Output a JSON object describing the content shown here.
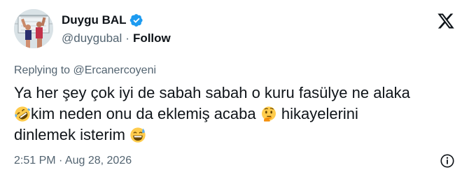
{
  "author": {
    "display_name": "Duygu BAL",
    "handle": "@duygubal",
    "separator": "·",
    "follow_label": "Follow"
  },
  "icons": {
    "verified": "verified-badge-icon",
    "brand": "x-logo-icon",
    "info": "info-icon",
    "emoji_laugh": "rolling-on-floor-laughing-emoji",
    "emoji_think": "thinking-face-emoji",
    "emoji_sweat": "grinning-face-with-sweat-emoji"
  },
  "reply": {
    "prefix": "Replying to ",
    "mention": "@Ercanercoyeni"
  },
  "tweet": {
    "line1": "Ya her şey çok iyi de sabah sabah o kuru fasülye ne alaka",
    "line2a": "kim neden onu da eklemiş acaba ",
    "line2b": " hikayelerini",
    "line3": "dinlemek isterim "
  },
  "meta": {
    "timestamp": "2:51 PM · Aug 28, 2026"
  },
  "colors": {
    "text_primary": "#0f1419",
    "text_secondary": "#536471",
    "verified": "#1d9bf0",
    "emoji_yellow": "#ffcc4d"
  }
}
